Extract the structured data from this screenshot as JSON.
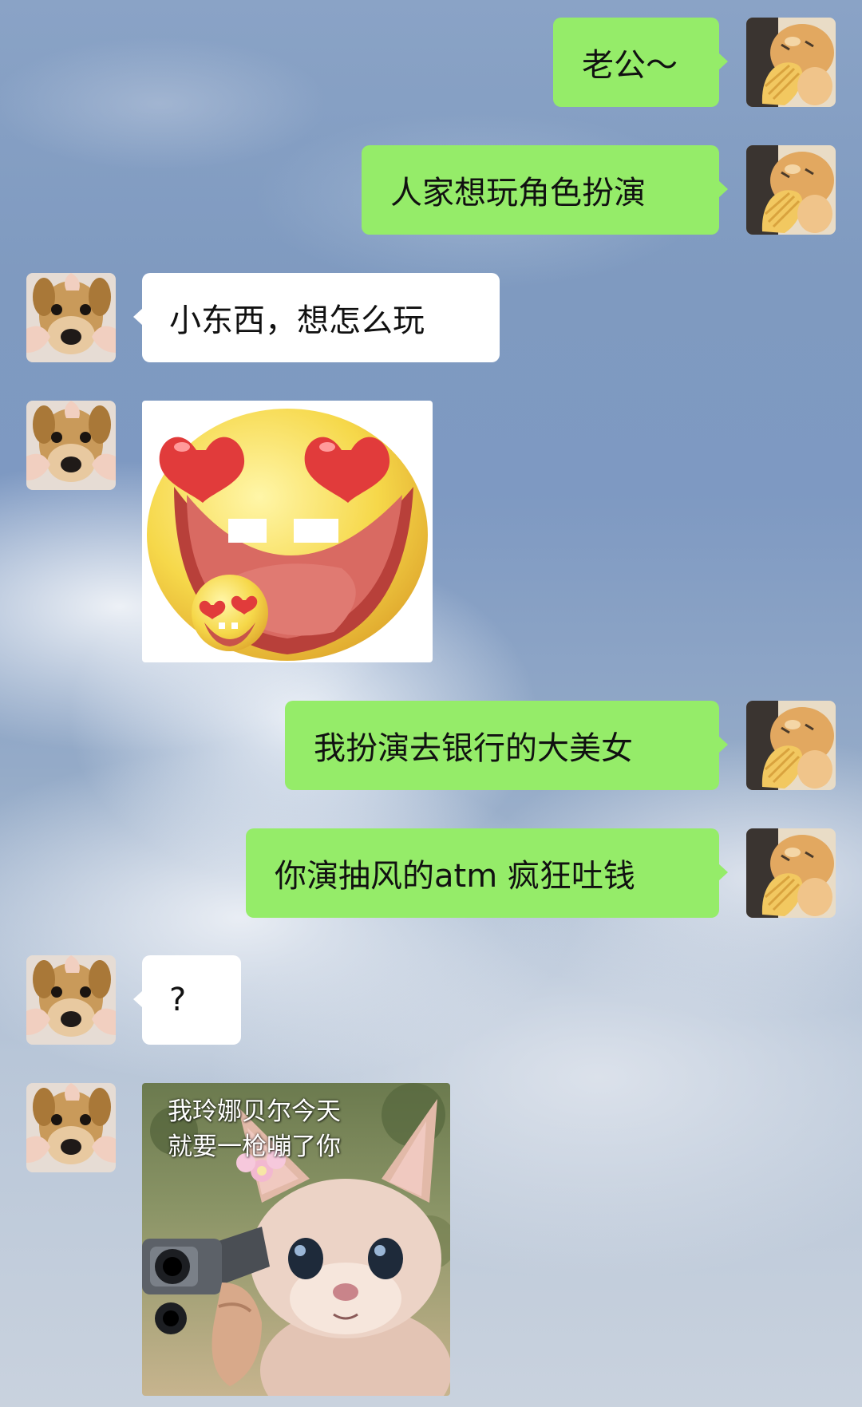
{
  "chat": {
    "messages": [
      {
        "side": "out",
        "type": "text",
        "text": "老公～"
      },
      {
        "side": "out",
        "type": "text",
        "text": "人家想玩角色扮演"
      },
      {
        "side": "in",
        "type": "text",
        "text": "小东西，想怎么玩"
      },
      {
        "side": "in",
        "type": "sticker",
        "sticker": "heart-eyes-emoji"
      },
      {
        "side": "out",
        "type": "text",
        "text": "我扮演去银行的大美女"
      },
      {
        "side": "out",
        "type": "text",
        "text": "你演抽风的atm 疯狂吐钱"
      },
      {
        "side": "in",
        "type": "text",
        "text": "?"
      },
      {
        "side": "in",
        "type": "sticker",
        "sticker": "plush-with-gun",
        "caption_line1": "我玲娜贝尔今天",
        "caption_line2": "就要一枪嘣了你"
      }
    ]
  },
  "colors": {
    "outgoing_bubble": "#95ec69",
    "incoming_bubble": "#ffffff"
  }
}
